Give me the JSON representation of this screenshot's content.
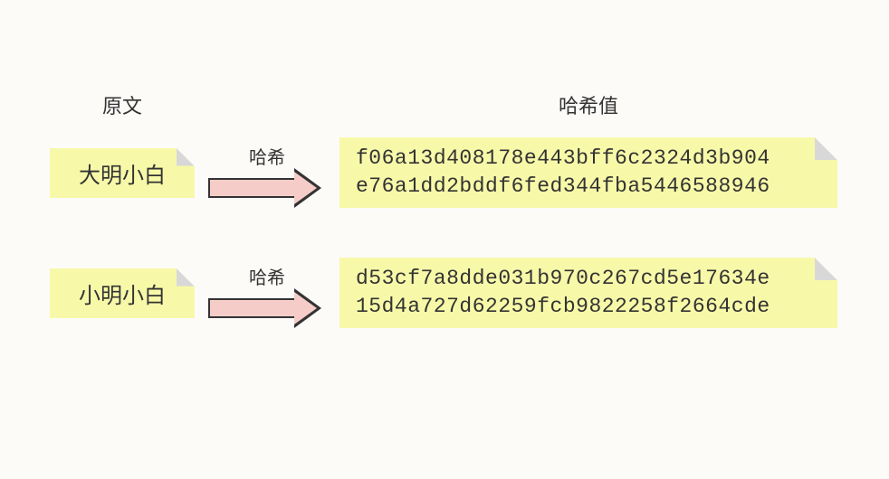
{
  "headers": {
    "plaintext": "原文",
    "hashvalue": "哈希值"
  },
  "arrow_label": "哈希",
  "rows": [
    {
      "plaintext": "大明小白",
      "hash_line1": "f06a13d408178e443bff6c2324d3b904",
      "hash_line2": "e76a1dd2bddf6fed344fba5446588946"
    },
    {
      "plaintext": "小明小白",
      "hash_line1": "d53cf7a8dde031b970c267cd5e17634e",
      "hash_line2": "15d4a727d62259fcb9822258f2664cde"
    }
  ]
}
